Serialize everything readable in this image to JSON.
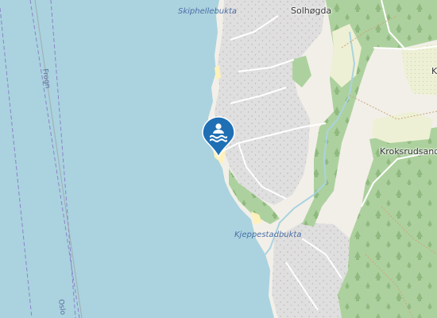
{
  "map": {
    "labels": {
      "solhogda": "Solhøgda",
      "skiphellebukta": "Skiphellebukta",
      "kroksrudsand": "Kroksrudsand",
      "kjeppestadbukta": "Kjeppestadbukta",
      "frogn": "Frogn",
      "oslo": "Oslo",
      "k_partial": "K"
    },
    "marker": {
      "type": "swimming-beach",
      "icon": "swimmer-icon",
      "color": "#1f6fb5"
    },
    "colors": {
      "water": "#aad3df",
      "land": "#f2efe9",
      "residential": "#e0dfdf",
      "forest": "#add19e",
      "meadow": "#eef0d5",
      "beach": "#fff1ba",
      "boundary": "#8c82c8"
    }
  }
}
